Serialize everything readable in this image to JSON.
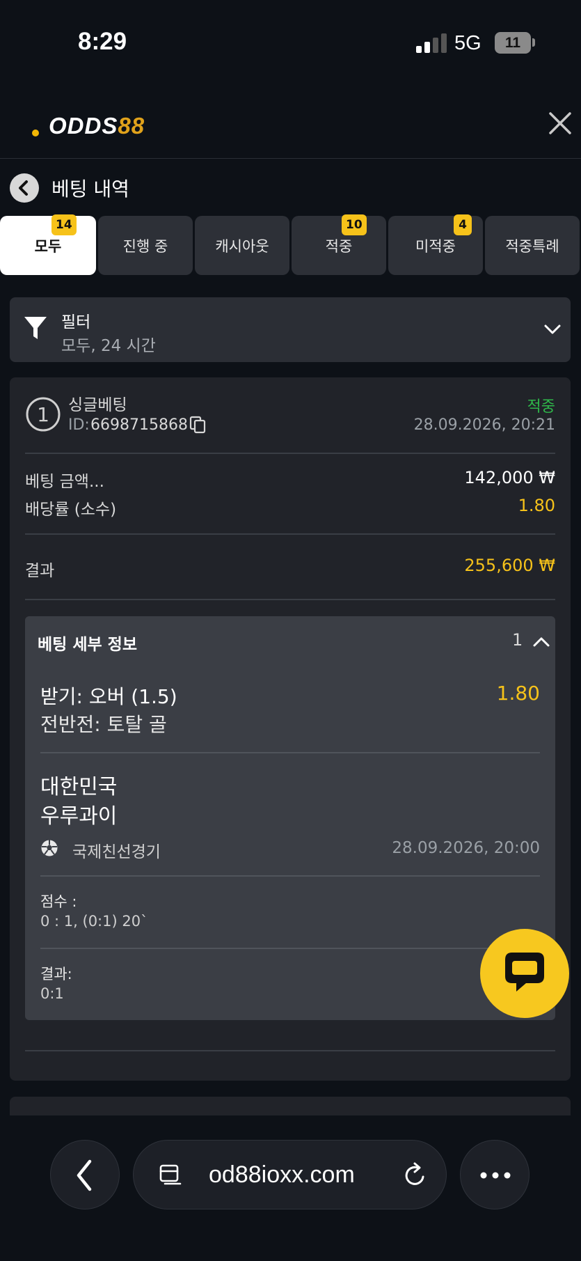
{
  "status_bar": {
    "time": "8:29",
    "network": "5G",
    "battery": "11"
  },
  "header": {
    "logo_prefix": "ODDS",
    "logo_suffix": "88"
  },
  "page": {
    "title": "베팅 내역"
  },
  "tabs": [
    {
      "label": "모두",
      "badge": "14",
      "active": true
    },
    {
      "label": "진행 중",
      "badge": ""
    },
    {
      "label": "캐시아웃",
      "badge": ""
    },
    {
      "label": "적중",
      "badge": "10"
    },
    {
      "label": "미적중",
      "badge": "4"
    },
    {
      "label": "적중특례",
      "badge": ""
    }
  ],
  "filter": {
    "title": "필터",
    "summary": "모두, 24 시간"
  },
  "bet": {
    "number": "1",
    "type": "싱글베팅",
    "id_label": "ID:",
    "id": "6698715868",
    "status": "적중",
    "placed_at": "28.09.2026, 20:21",
    "stake_label": "베팅 금액...",
    "stake": "142,000 ₩",
    "odds_label": "배당률 (소수)",
    "odds": "1.80",
    "result_label": "결과",
    "payout": "255,600 ₩",
    "details": {
      "title": "베팅 세부 정보",
      "count": "1",
      "selection": "받기: 오버 (1.5)",
      "market": "전반전: 토탈 골",
      "selection_odds": "1.80",
      "home_team": "대한민국",
      "away_team": "우루과이",
      "league": "국제친선경기",
      "match_time": "28.09.2026, 20:00",
      "score_label": "점수 :",
      "score": "0 : 1, (0:1) 20`",
      "result_label": "결과:",
      "result": "0:1"
    }
  },
  "browser": {
    "url": "od88ioxx.com"
  },
  "colors": {
    "accent_yellow": "#f6c21a",
    "win_green": "#2fb74a",
    "card_bg": "#212329",
    "panel_bg": "#3b3e45"
  }
}
